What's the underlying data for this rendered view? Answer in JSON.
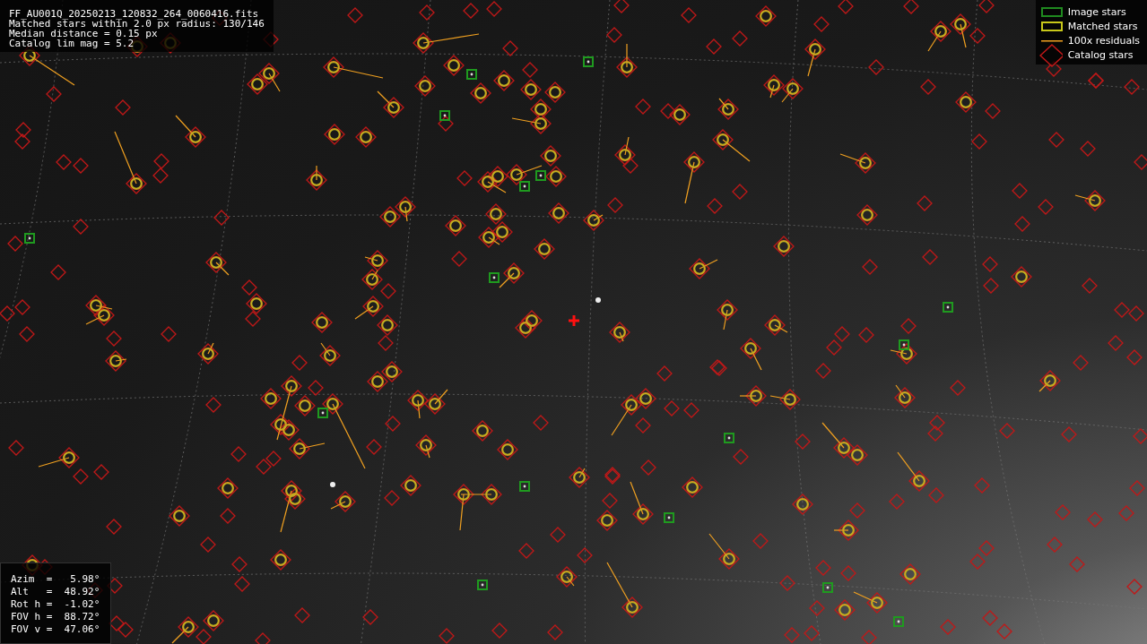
{
  "header": {
    "lines": [
      "FF_AU001Q_20250213_120832_264_0060416.fits",
      "Matched stars within 2.0 px radius: 130/146",
      "Median distance = 0.15 px",
      "Catalog lim mag = 5.2"
    ]
  },
  "legend": [
    {
      "kind": "image",
      "label": "Image stars"
    },
    {
      "kind": "matched",
      "label": "Matched stars"
    },
    {
      "kind": "residual",
      "label": "100x residuals"
    },
    {
      "kind": "catalog",
      "label": "Catalog stars"
    }
  ],
  "pointing": {
    "lines": [
      "Azim  =   5.98°",
      "Alt   =  48.92°",
      "Rot h =  -1.02°",
      "FOV h =  88.72°",
      "FOV v =  47.06°"
    ]
  }
}
